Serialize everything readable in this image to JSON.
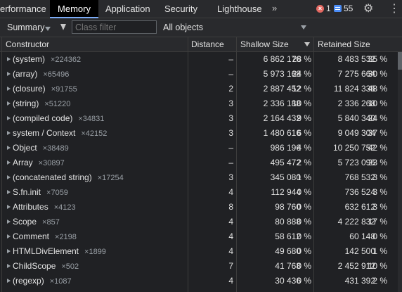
{
  "tabs": [
    {
      "label": "erformance",
      "active": false
    },
    {
      "label": "Memory",
      "active": true
    },
    {
      "label": "Application",
      "active": false
    },
    {
      "label": "Security",
      "active": false
    },
    {
      "label": "Lighthouse",
      "active": false
    }
  ],
  "more_tabs": "»",
  "status": {
    "errors": "1",
    "info": "55",
    "error_glyph": "×"
  },
  "icons": {
    "gear": "⚙",
    "kebab": "⋮"
  },
  "toolbar": {
    "view_select": "Summary",
    "class_filter_placeholder": "Class filter",
    "objects_select": "All objects"
  },
  "table": {
    "headers": {
      "constructor": "Constructor",
      "distance": "Distance",
      "shallow_size": "Shallow Size",
      "retained_size": "Retained Size"
    },
    "sort_column": "shallow_size",
    "rows": [
      {
        "name": "(system)",
        "count": "×224362",
        "distance": "–",
        "shallow": "6 862 176",
        "shallow_pct": "28 %",
        "retained": "8 483 532",
        "retained_pct": "35 %"
      },
      {
        "name": "(array)",
        "count": "×65496",
        "distance": "–",
        "shallow": "5 973 168",
        "shallow_pct": "24 %",
        "retained": "7 275 664",
        "retained_pct": "30 %"
      },
      {
        "name": "(closure)",
        "count": "×91755",
        "distance": "2",
        "shallow": "2 887 452",
        "shallow_pct": "12 %",
        "retained": "11 824 336",
        "retained_pct": "48 %"
      },
      {
        "name": "(string)",
        "count": "×51220",
        "distance": "3",
        "shallow": "2 336 188",
        "shallow_pct": "10 %",
        "retained": "2 336 268",
        "retained_pct": "10 %"
      },
      {
        "name": "(compiled code)",
        "count": "×34831",
        "distance": "3",
        "shallow": "2 164 432",
        "shallow_pct": "9 %",
        "retained": "5 840 340",
        "retained_pct": "24 %"
      },
      {
        "name": "system / Context",
        "count": "×42152",
        "distance": "3",
        "shallow": "1 480 616",
        "shallow_pct": "6 %",
        "retained": "9 049 304",
        "retained_pct": "37 %"
      },
      {
        "name": "Object",
        "count": "×38489",
        "distance": "–",
        "shallow": "986 196",
        "shallow_pct": "4 %",
        "retained": "10 250 752",
        "retained_pct": "42 %"
      },
      {
        "name": "Array",
        "count": "×30897",
        "distance": "–",
        "shallow": "495 472",
        "shallow_pct": "2 %",
        "retained": "5 723 096",
        "retained_pct": "23 %"
      },
      {
        "name": "(concatenated string)",
        "count": "×17254",
        "distance": "3",
        "shallow": "345 080",
        "shallow_pct": "1 %",
        "retained": "768 532",
        "retained_pct": "3 %"
      },
      {
        "name": "S.fn.init",
        "count": "×7059",
        "distance": "4",
        "shallow": "112 944",
        "shallow_pct": "0 %",
        "retained": "736 524",
        "retained_pct": "3 %"
      },
      {
        "name": "Attributes",
        "count": "×4123",
        "distance": "8",
        "shallow": "98 760",
        "shallow_pct": "0 %",
        "retained": "632 612",
        "retained_pct": "3 %"
      },
      {
        "name": "Scope",
        "count": "×857",
        "distance": "4",
        "shallow": "80 888",
        "shallow_pct": "0 %",
        "retained": "4 222 832",
        "retained_pct": "17 %"
      },
      {
        "name": "Comment",
        "count": "×2198",
        "distance": "4",
        "shallow": "58 612",
        "shallow_pct": "0 %",
        "retained": "60 148",
        "retained_pct": "0 %"
      },
      {
        "name": "HTMLDivElement",
        "count": "×1899",
        "distance": "4",
        "shallow": "49 680",
        "shallow_pct": "0 %",
        "retained": "142 500",
        "retained_pct": "1 %"
      },
      {
        "name": "ChildScope",
        "count": "×502",
        "distance": "7",
        "shallow": "41 768",
        "shallow_pct": "0 %",
        "retained": "2 452 912",
        "retained_pct": "10 %"
      },
      {
        "name": "(regexp)",
        "count": "×1087",
        "distance": "4",
        "shallow": "30 436",
        "shallow_pct": "0 %",
        "retained": "431 392",
        "retained_pct": "2 %"
      }
    ]
  }
}
